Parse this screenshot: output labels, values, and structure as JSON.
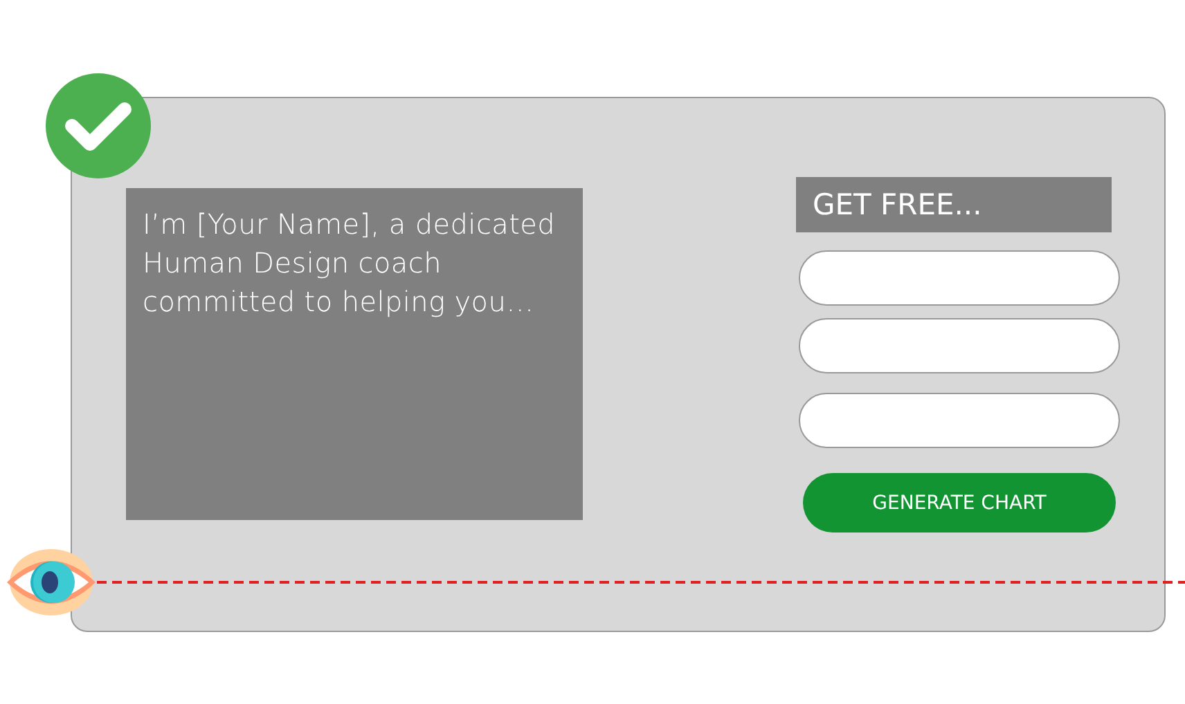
{
  "intro": {
    "text": "I’m [Your Name], a dedicated Human Design coach committed to helping you…"
  },
  "form": {
    "heading": "GET FREE...",
    "fields": [
      {
        "kind": "text"
      },
      {
        "kind": "text"
      },
      {
        "kind": "text"
      }
    ],
    "button": "GENERATE CHART"
  }
}
